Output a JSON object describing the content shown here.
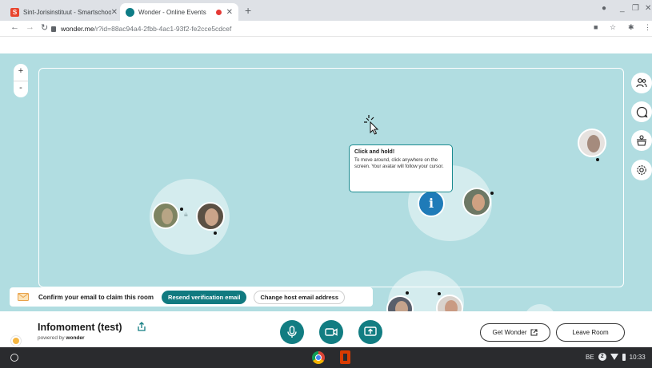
{
  "browser": {
    "tabs": [
      {
        "title": "Sint-Jorisinstituut - Smartschool",
        "favicon_letter": "S",
        "active": false
      },
      {
        "title": "Wonder - Online Events",
        "active": true,
        "recording": true
      }
    ],
    "new_tab": "+",
    "address": {
      "host": "wonder.me",
      "path": "/r?id=88ac94a4-2fbb-4ac1-93f2-fe2cce5cdcef"
    }
  },
  "stage": {
    "zoom_in": "+",
    "zoom_out": "-",
    "info_marker": "i",
    "tooltip": {
      "title": "Click and hold!",
      "body": "To move around, click anywhere on the screen. Your avatar will follow your cursor."
    },
    "side_buttons": [
      "people-icon",
      "chat-icon",
      "broadcast-icon",
      "settings-icon"
    ]
  },
  "banner": {
    "message": "Confirm your email to claim this room",
    "resend_label": "Resend verification email",
    "change_label": "Change host email address"
  },
  "appbar": {
    "room_name": "Infomoment (test)",
    "powered_prefix": "powered by",
    "powered_brand": "wonder",
    "get_wonder_label": "Get Wonder",
    "leave_label": "Leave Room"
  },
  "shelf": {
    "locale": "BE",
    "notification_count": "2",
    "time": "10:33"
  },
  "colors": {
    "stage_bg": "#b1dde1",
    "accent_teal": "#117a80",
    "info_blue": "#1f7bb8"
  }
}
